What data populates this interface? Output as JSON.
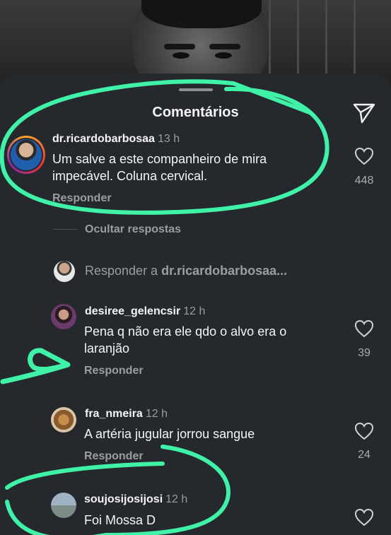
{
  "sheet": {
    "title": "Comentários"
  },
  "comments": [
    {
      "username": "dr.ricardobarbosaa",
      "time": "13 h",
      "text_line1": "Um salve a este companheiro de mira",
      "text_line2": "impecável. Coluna cervical.",
      "reply": "Responder",
      "likes": "448"
    },
    {
      "username": "desiree_gelencsir",
      "time": "12 h",
      "text_line1": "Pena q não era ele qdo o alvo era o",
      "text_line2": "laranjão",
      "reply": "Responder",
      "likes": "39"
    },
    {
      "username": "fra_nmeira",
      "time": "12 h",
      "text_line1": "A artéria jugular jorrou sangue",
      "reply": "Responder",
      "likes": "24"
    },
    {
      "username": "soujosijosijosi",
      "time": "12 h",
      "text_line1": "Foi Mossa D"
    }
  ],
  "thread": {
    "hide_replies": "Ocultar respostas",
    "reply_prefix": "Responder a ",
    "reply_target": "dr.ricardobarbosaa..."
  },
  "colors": {
    "sheet_bg": "#25282d",
    "annotation": "#3ff2a8",
    "muted_text": "#9a9da2"
  },
  "icons": [
    "send-icon",
    "heart-icon"
  ]
}
